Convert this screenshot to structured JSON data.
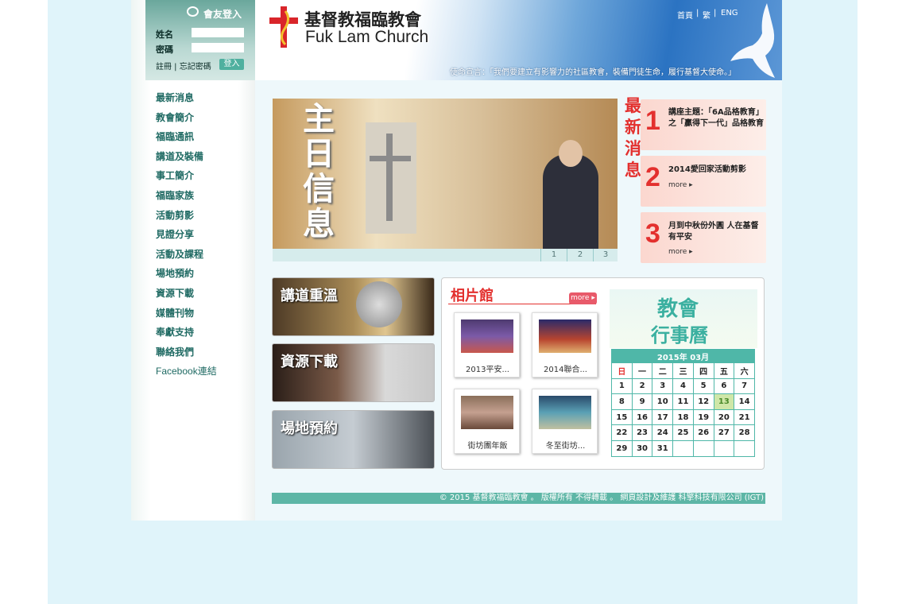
{
  "login": {
    "title": "會友登入",
    "name_label": "姓名",
    "password_label": "密碼",
    "links": "註冊 | 忘記密碼",
    "submit": "登入"
  },
  "nav": [
    "最新消息",
    "教會簡介",
    "福臨通訊",
    "講道及裝備",
    "事工簡介",
    "福臨家族",
    "活動剪影",
    "見證分享",
    "活動及課程",
    "場地預約",
    "資源下載",
    "媒體刊物",
    "奉獻支持",
    "聯絡我們",
    "Facebook連結"
  ],
  "header": {
    "church_name_zh": "基督教福臨教會",
    "church_name_en": "Fuk Lam Church",
    "links": {
      "home": "首頁",
      "trad": "繁",
      "eng": "ENG"
    },
    "mission": "使命宣言：「我們要建立有影響力的社區教會，裝備門徒生命，履行基督大使命。」"
  },
  "banner": {
    "title": "主日信息",
    "pages": [
      "1",
      "2",
      "3"
    ]
  },
  "news": {
    "heading": "最新消息",
    "items": [
      {
        "num": "1",
        "text": "講座主題：「6A品格教育」之「贏得下一代」品格教育"
      },
      {
        "num": "2",
        "text": "2014愛回家活動剪影",
        "more": "more ▸"
      },
      {
        "num": "3",
        "text": "月到中秋份外圓 人在基督有平安",
        "more": "more ▸"
      }
    ]
  },
  "buttons": [
    "講道重溫",
    "資源下載",
    "場地預約"
  ],
  "gallery": {
    "title": "相片館",
    "more": "more ▸",
    "photos": [
      "2013平安...",
      "2014聯合...",
      "街坊團年飯",
      "冬至街坊..."
    ]
  },
  "calendar": {
    "title_1": "教會",
    "title_2": "行事曆",
    "month": "2015年 03月",
    "weekdays": [
      "日",
      "一",
      "二",
      "三",
      "四",
      "五",
      "六"
    ],
    "weeks": [
      [
        "1",
        "2",
        "3",
        "4",
        "5",
        "6",
        "7"
      ],
      [
        "8",
        "9",
        "10",
        "11",
        "12",
        "13",
        "14"
      ],
      [
        "15",
        "16",
        "17",
        "18",
        "19",
        "20",
        "21"
      ],
      [
        "22",
        "23",
        "24",
        "25",
        "26",
        "27",
        "28"
      ],
      [
        "29",
        "30",
        "31",
        "",
        "",
        "",
        ""
      ]
    ],
    "today": "13"
  },
  "footer": "© 2015 基督教福臨教會 。 版權所有 不得轉載 。 網頁設計及維護 科擎科技有限公司 (IGT)",
  "colors": {
    "teal": "#5db6a6",
    "nav_text": "#1f6a63",
    "news_red": "#e3302e"
  }
}
